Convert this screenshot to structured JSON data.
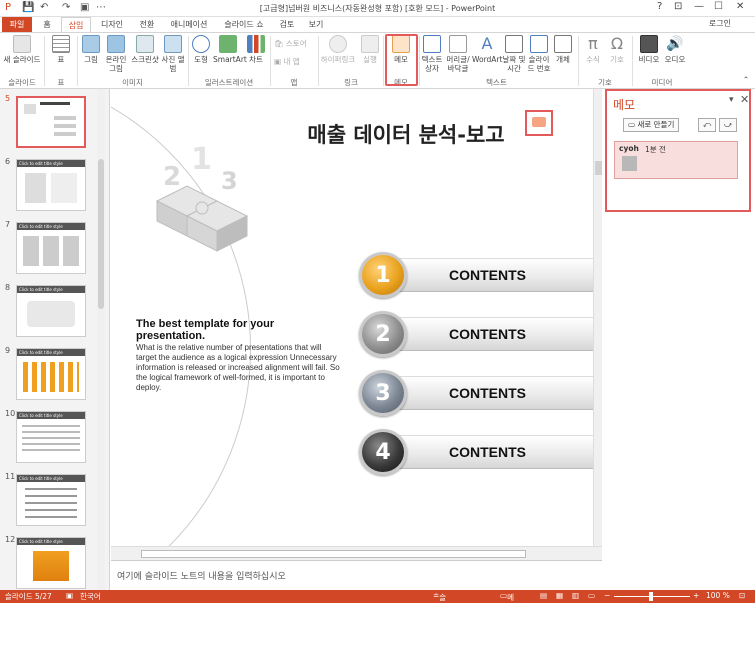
{
  "window": {
    "title": "[고급형]넘버원 비즈니스(자동완성형 포함) [호환 모드] - PowerPoint",
    "controls": [
      "?",
      "⊡",
      "—",
      "☐",
      "✕"
    ]
  },
  "quick_access": {
    "save": "💾",
    "undo": "↶",
    "redo": "↷",
    "start": "▣",
    "more": "⋯"
  },
  "tabs": [
    {
      "label": "파일"
    },
    {
      "label": "홈"
    },
    {
      "label": "삽입"
    },
    {
      "label": "디자인"
    },
    {
      "label": "전환"
    },
    {
      "label": "애니메이션"
    },
    {
      "label": "슬라이드 쇼"
    },
    {
      "label": "검토"
    },
    {
      "label": "보기"
    }
  ],
  "account": {
    "login": "로그인"
  },
  "ribbon": {
    "buttons": {
      "new_slide": "새 슬라이드",
      "table": "표",
      "picture": "그림",
      "online_picture": "온라인 그림",
      "screenshot": "스크린샷",
      "photo_album": "사진 앨범",
      "shapes": "도형",
      "smartart": "SmartArt",
      "chart": "차트",
      "store": "스토어",
      "my_apps": "내 앱",
      "hyperlink": "하이퍼링크",
      "action": "실행",
      "memo": "메모",
      "textbox": "텍스트 상자",
      "header_footer": "머리글/바닥글",
      "wordart": "WordArt",
      "date_time": "날짜 및 시간",
      "slide_number": "슬라이드 번호",
      "object": "개체",
      "equation": "수식",
      "symbol": "기호",
      "video": "비디오",
      "audio": "오디오"
    },
    "groups": {
      "slides": "슬라이드",
      "tables": "표",
      "images": "이미지",
      "illustrations": "일러스트레이션",
      "apps": "앱",
      "links": "링크",
      "comments": "메모",
      "text": "텍스트",
      "symbols": "기호",
      "media": "미디어"
    }
  },
  "thumbnails": [
    {
      "num": "5",
      "header": "",
      "selected": true
    },
    {
      "num": "6",
      "header": "Click to edit title style",
      "selected": false
    },
    {
      "num": "7",
      "header": "Click to edit title style",
      "selected": false
    },
    {
      "num": "8",
      "header": "Click to edit title style",
      "selected": false
    },
    {
      "num": "9",
      "header": "Click to edit title style",
      "selected": false
    },
    {
      "num": "10",
      "header": "Click to edit title style",
      "selected": false
    },
    {
      "num": "11",
      "header": "Click to edit title style",
      "selected": false
    },
    {
      "num": "12",
      "header": "Click to edit title style",
      "selected": false
    }
  ],
  "slide": {
    "title": "매출 데이터 분석-보고",
    "heading": "The best template for your presentation.",
    "body": "What is the relative number of presentations that will target the audience as a logical expression Unnecessary information is released or increased alignment will fail. So the logical framework of well-formed, it is important to deploy.",
    "items": [
      {
        "num": "1",
        "label": "CONTENTS",
        "color": "#e9a21d"
      },
      {
        "num": "2",
        "label": "CONTENTS",
        "color": "#8f8f8f"
      },
      {
        "num": "3",
        "label": "CONTENTS",
        "color": "#7d8793"
      },
      {
        "num": "4",
        "label": "CONTENTS",
        "color": "#3a3a3a"
      }
    ]
  },
  "notes": {
    "placeholder": "여기에 슬라이드 노트의 내용을 입력하십시오"
  },
  "memo_pane": {
    "title": "메모",
    "new_button": "새로 만들기",
    "prev": "⤺",
    "next": "⤻",
    "comment": {
      "author": "cyoh",
      "time": "1분 전"
    }
  },
  "status_bar": {
    "slide": "슬라이드 5/27",
    "language": "한국어",
    "notes": "슬라이드 노트",
    "memo": "메모",
    "zoom": "100 %"
  }
}
